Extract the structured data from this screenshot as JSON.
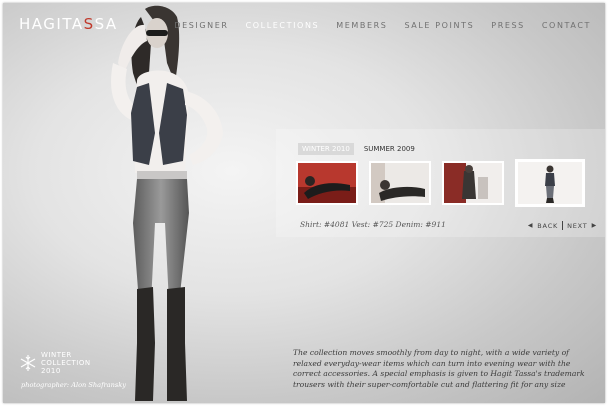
{
  "brand": {
    "logo_prefix": "HAGITA",
    "logo_accent": "S",
    "logo_suffix": "SA",
    "accent_color": "#c0392b"
  },
  "nav": {
    "items": [
      {
        "label": "DESIGNER",
        "active": false
      },
      {
        "label": "COLLECTIONS",
        "active": true
      },
      {
        "label": "MEMBERS",
        "active": false
      },
      {
        "label": "SALE POINTS",
        "active": false
      },
      {
        "label": "PRESS",
        "active": false
      },
      {
        "label": "CONTACT",
        "active": false
      }
    ]
  },
  "gallery": {
    "tabs": [
      {
        "label": "WINTER 2010",
        "active": true
      },
      {
        "label": "SUMMER 2009",
        "active": false
      }
    ],
    "selected_thumbnail": 4,
    "credits": "Shirt: #4081  Vest: #725  Denim: #911",
    "back_label": "BACK",
    "next_label": "NEXT"
  },
  "description": "The collection moves smoothly from day to night, with a wide variety of relaxed everyday-wear items which can turn into evening wear with the correct accessories. A special emphasis is given to Hagit Tassa's trademark trousers with their super-comfortable cut and flattering fit for any size",
  "season": {
    "line1": "WINTER",
    "line2": "COLLECTION",
    "line3": "2010",
    "icon": "snowflake-icon"
  },
  "photographer": "photographer: Alon Shafransky"
}
